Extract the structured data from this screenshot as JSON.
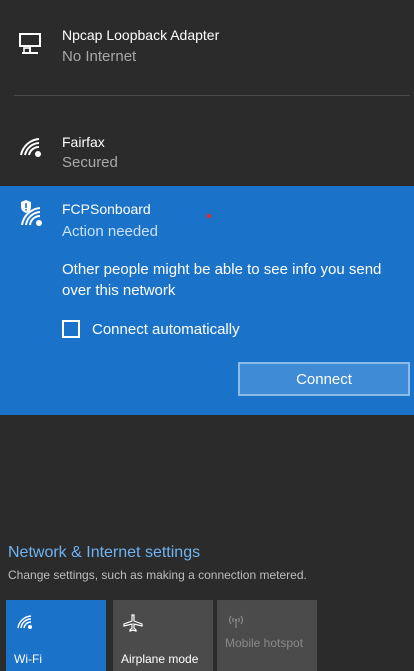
{
  "networks": [
    {
      "name": "Npcap Loopback Adapter",
      "status": "No Internet",
      "icon": "ethernet-icon"
    },
    {
      "name": "Fairfax",
      "status": "Secured",
      "icon": "wifi-secured-icon"
    },
    {
      "name": "FCPSonboard",
      "status": "Action needed",
      "icon": "wifi-shield-icon",
      "message": "Other people might be able to see info you send over this network",
      "checkbox_label": "Connect automatically",
      "checkbox_checked": false,
      "connect_label": "Connect"
    }
  ],
  "settings": {
    "title": "Network & Internet settings",
    "subtitle": "Change settings, such as making a connection metered."
  },
  "tiles": [
    {
      "label": "Wi-Fi",
      "icon": "wifi-icon",
      "active": true
    },
    {
      "label": "Airplane mode",
      "icon": "airplane-icon",
      "active": false
    },
    {
      "label": "Mobile hotspot",
      "icon": "hotspot-icon",
      "active": false,
      "disabled": true
    }
  ],
  "colors": {
    "accent": "#1a73c8",
    "background": "#2b2b2b",
    "link": "#6fb3f2"
  }
}
